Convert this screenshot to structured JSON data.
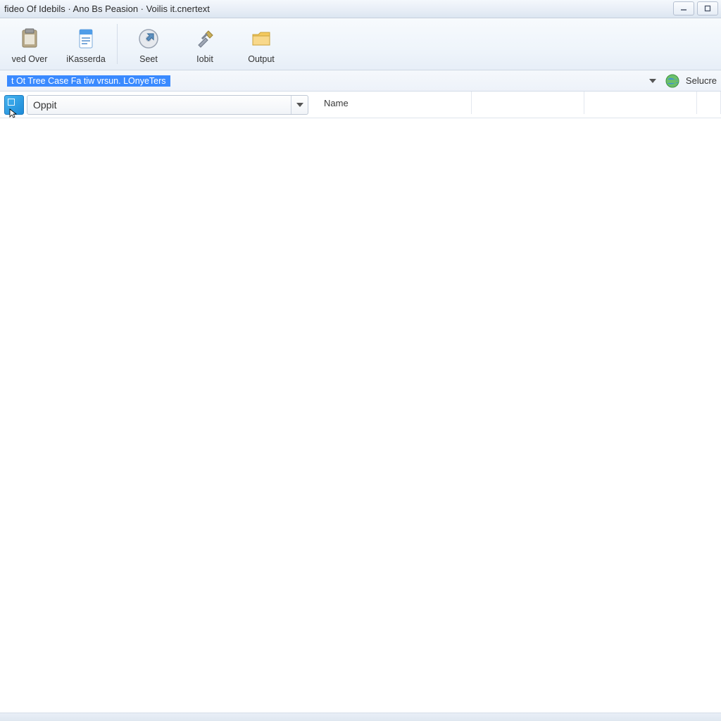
{
  "window": {
    "title": "fideo Of Idebils · Ano Bs Peasion · Voilis it.cnertext"
  },
  "toolbar": {
    "buttons": [
      {
        "id": "over",
        "label": "ved Over"
      },
      {
        "id": "kasserda",
        "label": "iKasserda"
      },
      {
        "id": "seet",
        "label": "Seet"
      },
      {
        "id": "iobit",
        "label": "Iobit"
      },
      {
        "id": "output",
        "label": "Output"
      }
    ]
  },
  "pathbar": {
    "selected_text": "t Ot Tree Case Fa tiw vrsun. LOnyeTers",
    "secure_label": "Selucre"
  },
  "subbar": {
    "combo_value": "Oppit"
  },
  "columns": {
    "name": "Name"
  }
}
